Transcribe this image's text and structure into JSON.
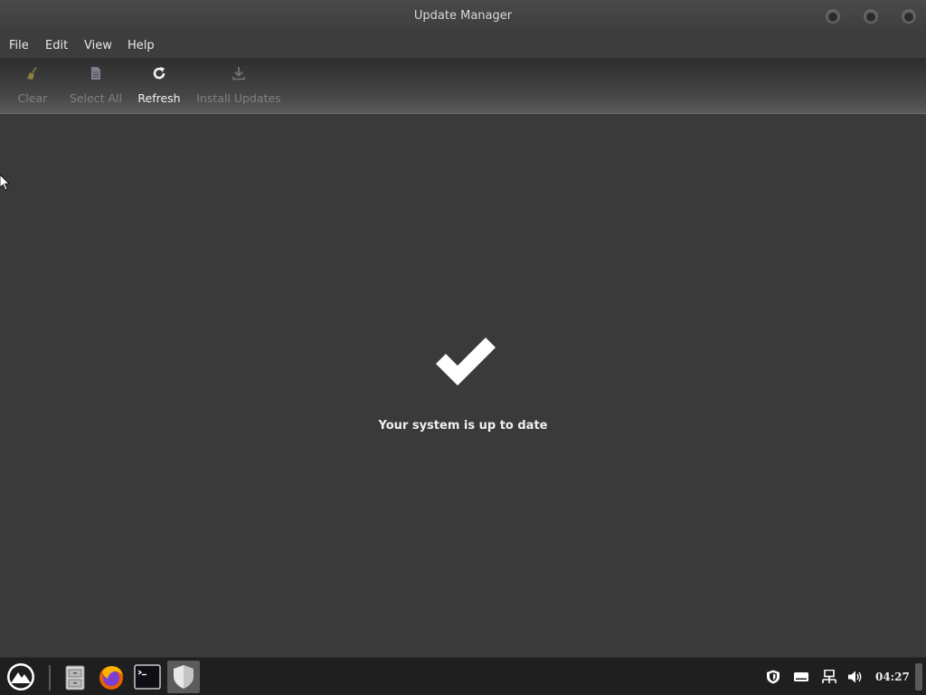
{
  "window": {
    "title": "Update Manager"
  },
  "menu": {
    "items": [
      "File",
      "Edit",
      "View",
      "Help"
    ]
  },
  "toolbar": {
    "items": [
      {
        "label": "Clear",
        "icon": "broom-icon",
        "enabled": false
      },
      {
        "label": "Select All",
        "icon": "document-icon",
        "enabled": false
      },
      {
        "label": "Refresh",
        "icon": "refresh-icon",
        "enabled": true
      },
      {
        "label": "Install Updates",
        "icon": "download-icon",
        "enabled": false
      }
    ]
  },
  "main": {
    "status_message": "Your system is up to date",
    "status_icon": "checkmark-icon"
  },
  "taskbar": {
    "launchers": [
      "menu-icon",
      "file-manager-icon",
      "firefox-icon",
      "terminal-icon",
      "update-manager-shield-icon"
    ],
    "tray": [
      "shield-icon",
      "keyboard-icon",
      "network-icon",
      "volume-icon"
    ],
    "clock": "04:27"
  },
  "colors": {
    "background": "#3a3a3a",
    "taskbar": "#1f1f1f",
    "text": "#e8e8e8",
    "disabled_text": "#808080"
  }
}
